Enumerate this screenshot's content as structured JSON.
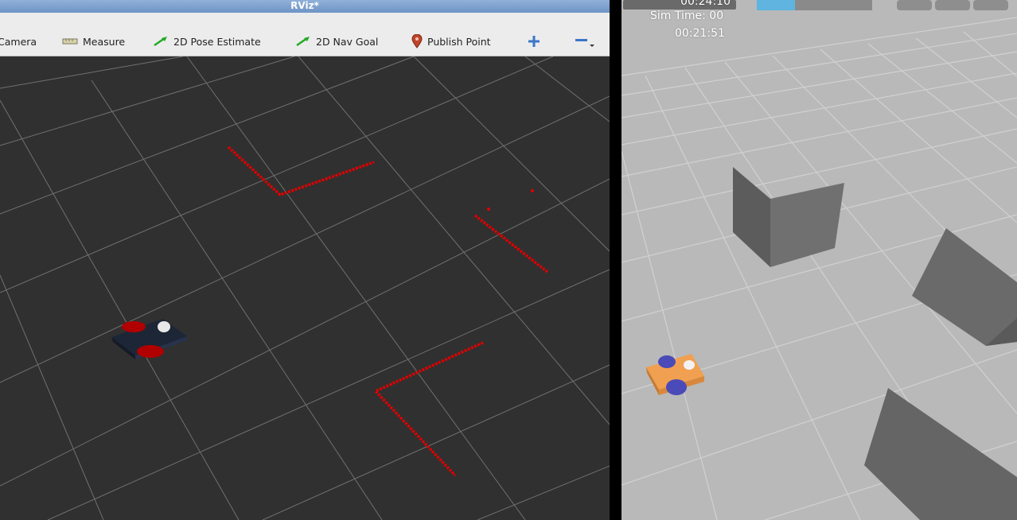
{
  "rviz": {
    "title": "RViz*",
    "toolbar": {
      "camera": "Camera",
      "measure": "Measure",
      "pose_estimate": "2D Pose Estimate",
      "nav_goal": "2D Nav Goal",
      "publish_point": "Publish Point",
      "add_icon": "plus-icon",
      "remove_icon": "minus-icon"
    },
    "colors": {
      "background": "#303030",
      "grid": "#a0a0a0",
      "laser": "#e00000"
    }
  },
  "gazebo": {
    "real_time": "00:24:10",
    "sim_time_label": "Sim Time: 00",
    "sim_time_value": "00:21:51",
    "colors": {
      "ground": "#b9b9b9",
      "grid": "#d2d2d2",
      "box": "#6e6e6e",
      "robot_body": "#f0a050",
      "robot_wheels": "#4a4ab8"
    }
  }
}
